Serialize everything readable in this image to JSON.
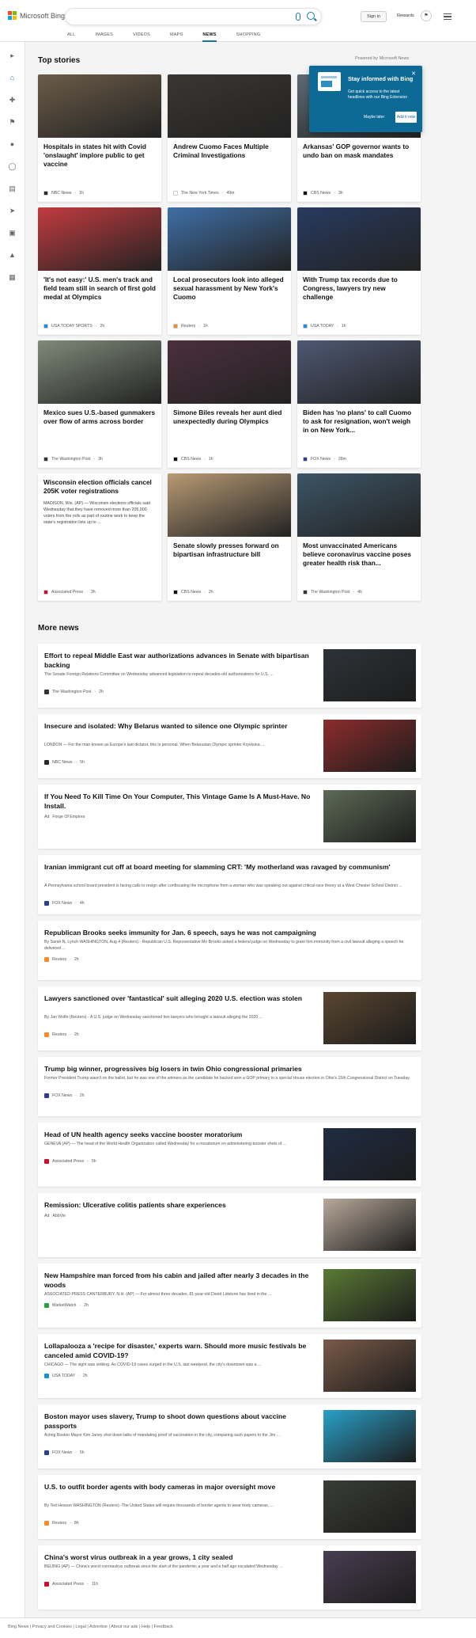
{
  "header": {
    "brand": "Microsoft Bing",
    "signin": "Sign in",
    "rewards": "Rewards",
    "nav": [
      "ALL",
      "IMAGES",
      "VIDEOS",
      "MAPS",
      "NEWS",
      "SHOPPING"
    ],
    "active_nav": "NEWS"
  },
  "sections": {
    "top": "Top stories",
    "powered": "Powered by Microsoft News",
    "more": "More news"
  },
  "popup": {
    "title": "Stay informed with Bing",
    "body": "Get quick access to the latest headlines with our Bing Extension",
    "later": "Maybe later",
    "add": "Add it now"
  },
  "top_stories": [
    {
      "title": "Hospitals in states hit with Covid 'onslaught' implore public to get vaccine",
      "source": "NBC News",
      "time": "1h",
      "color": "#6b5c48",
      "logo": "#2b2b2b"
    },
    {
      "title": "Andrew Cuomo Faces Multiple Criminal Investigations",
      "source": "The New York Times",
      "time": "49m",
      "color": "#3a3632",
      "logo": "#fff"
    },
    {
      "title": "Arkansas' GOP governor wants to undo ban on mask mandates",
      "source": "CBS News",
      "time": "3h",
      "color": "#5d6b74",
      "logo": "#111"
    },
    {
      "title": "'It's not easy:' U.S. men's track and field team still in search of first gold medal at Olympics",
      "source": "USA TODAY SPORTS",
      "time": "2h",
      "color": "#c23b3f",
      "logo": "#1b8fd8"
    },
    {
      "title": "Local prosecutors look into alleged sexual harassment by New York's Cuomo",
      "source": "Reuters",
      "time": "1h",
      "color": "#3f6fa6",
      "logo": "#f08c2c"
    },
    {
      "title": "With Trump tax records due to Congress, lawyers try new challenge",
      "source": "USA TODAY",
      "time": "1h",
      "color": "#273a5f",
      "logo": "#1b8fd8"
    },
    {
      "title": "Mexico sues U.S.-based gunmakers over flow of arms across border",
      "source": "The Washington Post",
      "time": "3h",
      "color": "#7f8a7a",
      "logo": "#333"
    },
    {
      "title": "Simone Biles reveals her aunt died unexpectedly during Olympics",
      "source": "CBS News",
      "time": "1h",
      "color": "#4b2f3c",
      "logo": "#111"
    },
    {
      "title": "Biden has 'no plans' to call Cuomo to ask for resignation, won't weigh in on New York...",
      "source": "FOX News",
      "time": "28m",
      "color": "#4e5873",
      "logo": "#2a3f8f"
    },
    {
      "title": "Wisconsin election officials cancel 205K voter registrations",
      "source": "Associated Press",
      "time": "3h",
      "color": "",
      "logo": "#c8102e",
      "snippet": "MADISON, Wis. (AP) — Wisconsin elections officials said Wednesday that they have removed more than 205,000 voters from the rolls as part of routine work to keep the state's registration lists up to ..."
    },
    {
      "title": "Senate slowly presses forward on bipartisan infrastructure bill",
      "source": "CBS News",
      "time": "2h",
      "color": "#b89a74",
      "logo": "#111"
    },
    {
      "title": "Most unvaccinated Americans believe coronavirus vaccine poses greater health risk than...",
      "source": "The Washington Post",
      "time": "4h",
      "color": "#3c5566",
      "logo": "#333"
    }
  ],
  "more_news": [
    {
      "title": "Effort to repeal Middle East war authorizations advances in Senate with bipartisan backing",
      "snippet": "The Senate Foreign Relations Committee on Wednesday advanced legislation to repeal decades-old authorizations for U.S. ...",
      "source": "The Washington Post",
      "time": "2h",
      "color": "#2e3338",
      "logo": "#333"
    },
    {
      "title": "Insecure and isolated: Why Belarus wanted to silence one Olympic sprinter",
      "snippet": "LONDON — For the man known as Europe's last dictator, this is personal. When Belarusian Olympic sprinter Krystsina ...",
      "source": "NBC News",
      "time": "5h",
      "color": "#8d2c2c",
      "logo": "#2b2b2b"
    },
    {
      "title": "If You Need To Kill Time On Your Computer, This Vintage Game Is A Must-Have. No Install.",
      "snippet": "",
      "source": "Forge Of Empires",
      "time": "",
      "ad": "Ad",
      "color": "#5d6a55",
      "logo": ""
    },
    {
      "title": "Iranian immigrant cut off at board meeting for slamming CRT: 'My motherland was ravaged by communism'",
      "snippet": "A Pennsylvania school board president is facing calls to resign after confiscating the microphone from a woman who was speaking out against critical race theory at a West Chester School District ...",
      "source": "FOX News",
      "time": "4h",
      "color": "",
      "logo": "#2a3f8f"
    },
    {
      "title": "Republican Brooks seeks immunity for Jan. 6 speech, says he was not campaigning",
      "snippet": "By Sarah N. Lynch WASHINGTON, Aug 4 (Reuters) - Republican U.S. Representative Mo Brooks asked a federal judge on Wednesday to grant him immunity from a civil lawsuit alleging a speech he delivered ...",
      "source": "Reuters",
      "time": "2h",
      "color": "",
      "logo": "#f08c2c"
    },
    {
      "title": "Lawyers sanctioned over 'fantastical' suit alleging 2020 U.S. election was stolen",
      "snippet": "By Jan Wolfe (Reuters) - A U.S. judge on Wednesday sanctioned two lawyers who brought a lawsuit alleging the 2020 ...",
      "source": "Reuters",
      "time": "2h",
      "color": "#5a4630",
      "logo": "#f08c2c"
    },
    {
      "title": "Trump big winner, progressives big losers in twin Ohio congressional primaries",
      "snippet": "Former President Trump wasn't on the ballot, but he was one of the winners as the candidate he backed won a GOP primary in a special House election in Ohio's 15th Congressional District on Tuesday.",
      "source": "FOX News",
      "time": "2h",
      "color": "",
      "logo": "#2a3f8f"
    },
    {
      "title": "Head of UN health agency seeks vaccine booster moratorium",
      "snippet": "GENEVA (AP) — The head of the World Health Organization called Wednesday for a moratorium on administering booster shots of ...",
      "source": "Associated Press",
      "time": "5h",
      "color": "#1f2c44",
      "logo": "#c8102e"
    },
    {
      "title": "Remission: Ulcerative colitis patients share experiences",
      "snippet": "",
      "source": "AbbVie",
      "time": "",
      "ad": "Ad",
      "color": "#b8a99a",
      "logo": ""
    },
    {
      "title": "New Hampshire man forced from his cabin and jailed after nearly 3 decades in the woods",
      "snippet": "ASSOCIATED PRESS CANTERBURY, N.H. (AP) — For almost three decades, 81-year-old David Lidstone has lived in the ...",
      "source": "MarketWatch",
      "time": "2h",
      "color": "#5a7a34",
      "logo": "#2e9d47"
    },
    {
      "title": "Lollapalooza a 'recipe for disaster,' experts warn. Should more music festivals be canceled amid COVID-19?",
      "snippet": "CHICAGO — The sight was striking. As COVID-19 cases surged in the U.S. last weekend, the city's downtown was a ...",
      "source": "USA TODAY",
      "time": "2h",
      "color": "#7a5a48",
      "logo": "#1b8fd8"
    },
    {
      "title": "Boston mayor uses slavery, Trump to shoot down questions about vaccine passports",
      "snippet": "Acting Boston Mayor Kim Janey shot down talks of mandating proof of vaccination in the city, comparing such papers to the Jim ...",
      "source": "FOX News",
      "time": "5h",
      "color": "#2aa0c8",
      "logo": "#2a3f8f"
    },
    {
      "title": "U.S. to outfit border agents with body cameras in major oversight move",
      "snippet": "By Ted Hesson WASHINGTON (Reuters) -The United States will require thousands of border agents to wear body cameras, ...",
      "source": "Reuters",
      "time": "8h",
      "color": "#3a3d36",
      "logo": "#f08c2c"
    },
    {
      "title": "China's worst virus outbreak in a year grows, 1 city sealed",
      "snippet": "BEIJING (AP) — China's worst coronavirus outbreak since the start of the pandemic a year and a half ago escalated Wednesday ...",
      "source": "Associated Press",
      "time": "11h",
      "color": "#4a3e52",
      "logo": "#c8102e"
    }
  ],
  "footer": "Bing News | Privacy and Cookies | Legal | Advertise | About our ads | Help | Feedback"
}
